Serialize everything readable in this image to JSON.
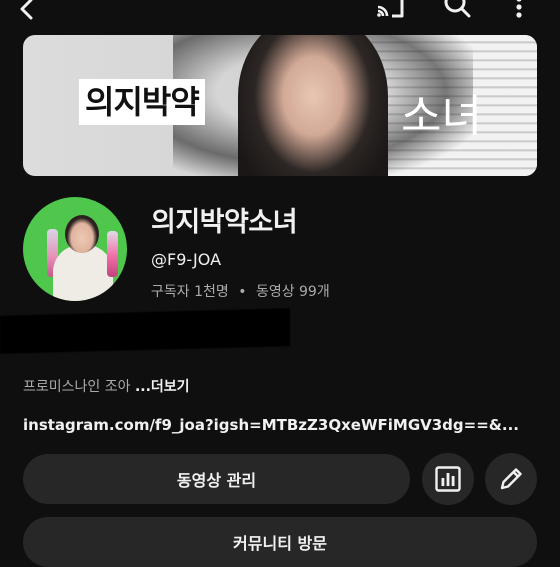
{
  "banner": {
    "left_text": "의지박약",
    "right_text": "소녀"
  },
  "channel": {
    "name": "의지박약소녀",
    "handle": "@F9-JOA",
    "subscribers": "구독자 1천명",
    "separator": "•",
    "videos": "동영상 99개",
    "description": "프로미스나인 조아 ",
    "more_label": "...더보기",
    "link": "instagram.com/f9_joa?igsh=MTBzZ3QxeWFiMGV3dg==&..."
  },
  "actions": {
    "manage_videos": "동영상 관리",
    "community": "커뮤니티 방문"
  },
  "icons": {
    "back": "back-arrow-icon",
    "cast": "cast-icon",
    "search": "search-icon",
    "more": "more-vertical-icon",
    "analytics": "analytics-icon",
    "edit": "edit-pencil-icon"
  },
  "colors": {
    "background": "#0f0f0f",
    "surface": "#272727",
    "text_primary": "#f1f1f1",
    "text_secondary": "#aaaaaa"
  }
}
